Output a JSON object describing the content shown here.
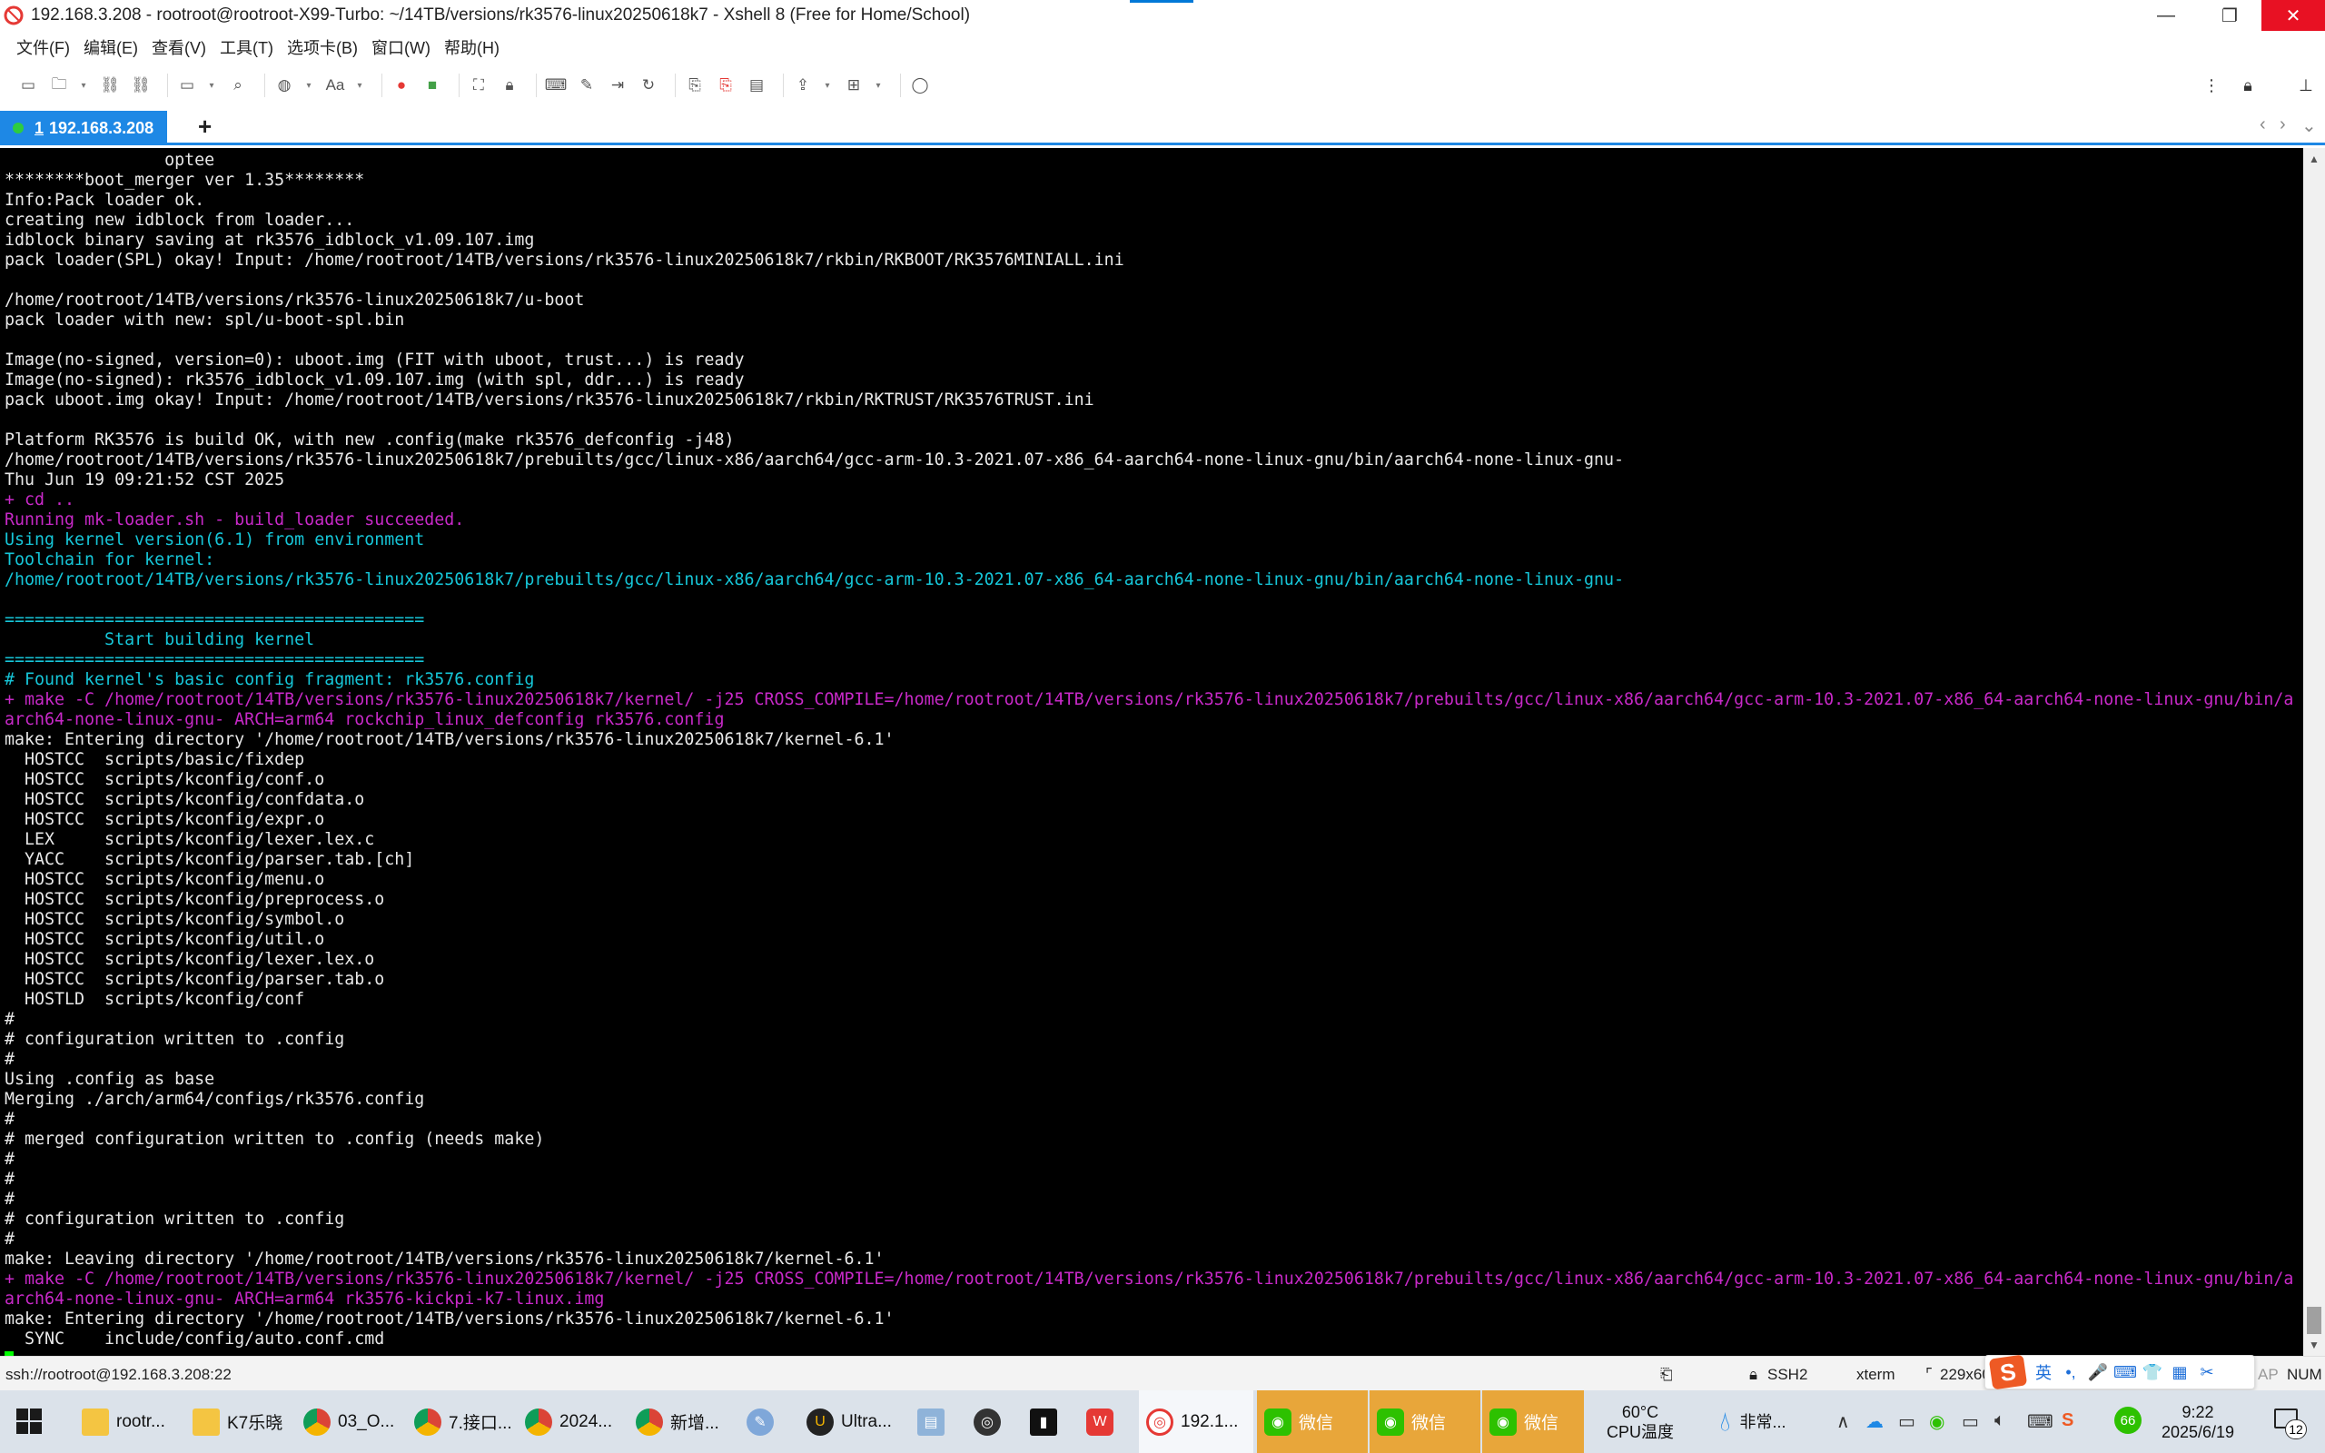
{
  "window": {
    "title": "192.168.3.208 - rootroot@rootroot-X99-Turbo: ~/14TB/versions/rk3576-linux20250618k7 - Xshell 8 (Free for Home/School)",
    "minimize_glyph": "—",
    "maximize_glyph": "❐",
    "close_glyph": "✕"
  },
  "menu": [
    "文件(F)",
    "编辑(E)",
    "查看(V)",
    "工具(T)",
    "选项卡(B)",
    "窗口(W)",
    "帮助(H)"
  ],
  "toolbar": {
    "icons": [
      "new-session-icon",
      "open-folder-icon",
      "dropdown-icon",
      "reconnect-icon",
      "disconnect-icon",
      "new-tab-icon",
      "dropdown-icon",
      "search-icon",
      "globe-icon",
      "dropdown-icon",
      "font-icon",
      "dropdown-icon",
      "xftp-icon",
      "xshell-green-icon",
      "lock-icon",
      "fullscreen-icon",
      "keyboard-icon",
      "compose-icon",
      "script-icon",
      "macro-icon",
      "transfer-icon",
      "record-icon",
      "log-icon",
      "file-transfer-icon",
      "dropdown-icon",
      "layout-icon",
      "dropdown-icon",
      "chat-icon"
    ],
    "font_label": "Aa"
  },
  "tabs": [
    {
      "number": "1",
      "label": "192.168.3.208",
      "status_color": "#2ecc40"
    }
  ],
  "add_tab_glyph": "+",
  "terminal": {
    "lines": [
      {
        "text": "                optee",
        "color": "white"
      },
      {
        "text": "********boot_merger ver 1.35********",
        "color": "white"
      },
      {
        "text": "Info:Pack loader ok.",
        "color": "white"
      },
      {
        "text": "creating new idblock from loader...",
        "color": "white"
      },
      {
        "text": "idblock binary saving at rk3576_idblock_v1.09.107.img",
        "color": "white"
      },
      {
        "text": "pack loader(SPL) okay! Input: /home/rootroot/14TB/versions/rk3576-linux20250618k7/rkbin/RKBOOT/RK3576MINIALL.ini",
        "color": "white"
      },
      {
        "text": "",
        "color": "white"
      },
      {
        "text": "/home/rootroot/14TB/versions/rk3576-linux20250618k7/u-boot",
        "color": "white"
      },
      {
        "text": "pack loader with new: spl/u-boot-spl.bin",
        "color": "white"
      },
      {
        "text": "",
        "color": "white"
      },
      {
        "text": "Image(no-signed, version=0): uboot.img (FIT with uboot, trust...) is ready",
        "color": "white"
      },
      {
        "text": "Image(no-signed): rk3576_idblock_v1.09.107.img (with spl, ddr...) is ready",
        "color": "white"
      },
      {
        "text": "pack uboot.img okay! Input: /home/rootroot/14TB/versions/rk3576-linux20250618k7/rkbin/RKTRUST/RK3576TRUST.ini",
        "color": "white"
      },
      {
        "text": "",
        "color": "white"
      },
      {
        "text": "Platform RK3576 is build OK, with new .config(make rk3576_defconfig -j48)",
        "color": "white"
      },
      {
        "text": "/home/rootroot/14TB/versions/rk3576-linux20250618k7/prebuilts/gcc/linux-x86/aarch64/gcc-arm-10.3-2021.07-x86_64-aarch64-none-linux-gnu/bin/aarch64-none-linux-gnu-",
        "color": "white"
      },
      {
        "text": "Thu Jun 19 09:21:52 CST 2025",
        "color": "white"
      },
      {
        "text": "+ cd ..",
        "color": "magenta"
      },
      {
        "text": "Running mk-loader.sh - build_loader succeeded.",
        "color": "magenta"
      },
      {
        "text": "Using kernel version(6.1) from environment",
        "color": "cyan"
      },
      {
        "text": "Toolchain for kernel:",
        "color": "cyan"
      },
      {
        "text": "/home/rootroot/14TB/versions/rk3576-linux20250618k7/prebuilts/gcc/linux-x86/aarch64/gcc-arm-10.3-2021.07-x86_64-aarch64-none-linux-gnu/bin/aarch64-none-linux-gnu-",
        "color": "cyan"
      },
      {
        "text": "",
        "color": "white"
      },
      {
        "text": "==========================================",
        "color": "cyan"
      },
      {
        "text": "          Start building kernel",
        "color": "cyan"
      },
      {
        "text": "==========================================",
        "color": "cyan"
      },
      {
        "text": "# Found kernel's basic config fragment: rk3576.config",
        "color": "cyan"
      },
      {
        "text": "+ make -C /home/rootroot/14TB/versions/rk3576-linux20250618k7/kernel/ -j25 CROSS_COMPILE=/home/rootroot/14TB/versions/rk3576-linux20250618k7/prebuilts/gcc/linux-x86/aarch64/gcc-arm-10.3-2021.07-x86_64-aarch64-none-linux-gnu/bin/a",
        "color": "magenta"
      },
      {
        "text": "arch64-none-linux-gnu- ARCH=arm64 rockchip_linux_defconfig rk3576.config",
        "color": "magenta"
      },
      {
        "text": "make: Entering directory '/home/rootroot/14TB/versions/rk3576-linux20250618k7/kernel-6.1'",
        "color": "white"
      },
      {
        "text": "  HOSTCC  scripts/basic/fixdep",
        "color": "white"
      },
      {
        "text": "  HOSTCC  scripts/kconfig/conf.o",
        "color": "white"
      },
      {
        "text": "  HOSTCC  scripts/kconfig/confdata.o",
        "color": "white"
      },
      {
        "text": "  HOSTCC  scripts/kconfig/expr.o",
        "color": "white"
      },
      {
        "text": "  LEX     scripts/kconfig/lexer.lex.c",
        "color": "white"
      },
      {
        "text": "  YACC    scripts/kconfig/parser.tab.[ch]",
        "color": "white"
      },
      {
        "text": "  HOSTCC  scripts/kconfig/menu.o",
        "color": "white"
      },
      {
        "text": "  HOSTCC  scripts/kconfig/preprocess.o",
        "color": "white"
      },
      {
        "text": "  HOSTCC  scripts/kconfig/symbol.o",
        "color": "white"
      },
      {
        "text": "  HOSTCC  scripts/kconfig/util.o",
        "color": "white"
      },
      {
        "text": "  HOSTCC  scripts/kconfig/lexer.lex.o",
        "color": "white"
      },
      {
        "text": "  HOSTCC  scripts/kconfig/parser.tab.o",
        "color": "white"
      },
      {
        "text": "  HOSTLD  scripts/kconfig/conf",
        "color": "white"
      },
      {
        "text": "#",
        "color": "white"
      },
      {
        "text": "# configuration written to .config",
        "color": "white"
      },
      {
        "text": "#",
        "color": "white"
      },
      {
        "text": "Using .config as base",
        "color": "white"
      },
      {
        "text": "Merging ./arch/arm64/configs/rk3576.config",
        "color": "white"
      },
      {
        "text": "#",
        "color": "white"
      },
      {
        "text": "# merged configuration written to .config (needs make)",
        "color": "white"
      },
      {
        "text": "#",
        "color": "white"
      },
      {
        "text": "#",
        "color": "white"
      },
      {
        "text": "#",
        "color": "white"
      },
      {
        "text": "# configuration written to .config",
        "color": "white"
      },
      {
        "text": "#",
        "color": "white"
      },
      {
        "text": "make: Leaving directory '/home/rootroot/14TB/versions/rk3576-linux20250618k7/kernel-6.1'",
        "color": "white"
      },
      {
        "text": "+ make -C /home/rootroot/14TB/versions/rk3576-linux20250618k7/kernel/ -j25 CROSS_COMPILE=/home/rootroot/14TB/versions/rk3576-linux20250618k7/prebuilts/gcc/linux-x86/aarch64/gcc-arm-10.3-2021.07-x86_64-aarch64-none-linux-gnu/bin/a",
        "color": "magenta"
      },
      {
        "text": "arch64-none-linux-gnu- ARCH=arm64 rk3576-kickpi-k7-linux.img",
        "color": "magenta"
      },
      {
        "text": "make: Entering directory '/home/rootroot/14TB/versions/rk3576-linux20250618k7/kernel-6.1'",
        "color": "white"
      },
      {
        "text": "  SYNC    include/config/auto.conf.cmd",
        "color": "white"
      }
    ],
    "colors": {
      "white": "#e8e8e8",
      "cyan": "#16c6d8",
      "magenta": "#c829c8",
      "cursor": "#00ff00"
    }
  },
  "statusbar": {
    "connection": "ssh://rootroot@192.168.3.208:22",
    "protocol": "SSH2",
    "terminal_type": "xterm",
    "size": "229x60",
    "caps": "AP",
    "num": "NUM"
  },
  "ime": {
    "logo": "S",
    "items": [
      "英",
      "•,",
      "🎤",
      "⌨",
      "👕",
      "▦",
      "✂"
    ]
  },
  "taskbar": {
    "tasks": [
      {
        "label": "rootr...",
        "icon": "folder-icon"
      },
      {
        "label": "K7乐晓",
        "icon": "folder-icon"
      },
      {
        "label": "03_O...",
        "icon": "chrome-icon"
      },
      {
        "label": "7.接口...",
        "icon": "chrome-icon"
      },
      {
        "label": "2024...",
        "icon": "chrome-icon"
      },
      {
        "label": "新增...",
        "icon": "chrome-icon"
      },
      {
        "label": "",
        "icon": "tool-icon"
      },
      {
        "label": "Ultra...",
        "icon": "ultraedit-icon"
      },
      {
        "label": "",
        "icon": "notepad-icon"
      },
      {
        "label": "",
        "icon": "obs-icon"
      },
      {
        "label": "",
        "icon": "terminal-icon"
      },
      {
        "label": "",
        "icon": "wps-icon"
      },
      {
        "label": "192.1...",
        "icon": "xshell-icon"
      },
      {
        "label": "微信",
        "icon": "wechat-icon"
      },
      {
        "label": "微信",
        "icon": "wechat-icon"
      },
      {
        "label": "微信",
        "icon": "wechat-icon"
      }
    ],
    "temp": "60°C",
    "cpu_label": "CPU温度",
    "weather": "非常...",
    "time": "9:22",
    "date": "2025/6/19",
    "notification_count": "12",
    "badge_66": "66"
  }
}
